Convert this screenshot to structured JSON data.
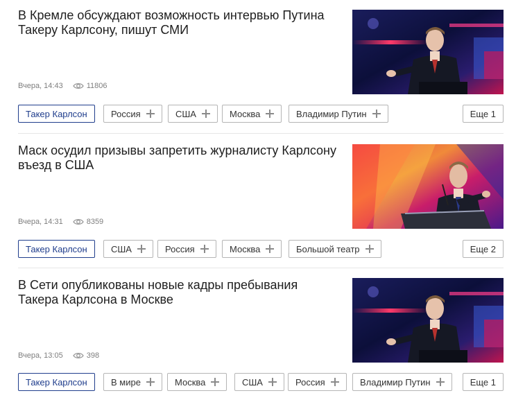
{
  "articles": [
    {
      "title": "В Кремле обсуждают возможность интервью Путина Такеру Карлсону, пишут СМИ",
      "date": "Вчера, 14:43",
      "views": "11806",
      "tags": [
        {
          "label": "Такер Карлсон",
          "active": true
        },
        {
          "label": "Россия"
        },
        {
          "label": "США"
        },
        {
          "label": "Москва"
        },
        {
          "label": "Владимир Путин"
        }
      ],
      "more_label": "Еще 1"
    },
    {
      "title": "Маск осудил призывы запретить журналисту Карлсону въезд в США",
      "date": "Вчера, 14:31",
      "views": "8359",
      "tags": [
        {
          "label": "Такер Карлсон",
          "active": true
        },
        {
          "label": "США"
        },
        {
          "label": "Россия"
        },
        {
          "label": "Москва"
        },
        {
          "label": "Большой театр"
        }
      ],
      "more_label": "Еще 2"
    },
    {
      "title": "В Сети опубликованы новые кадры пребывания Такера Карлсона в Москве",
      "date": "Вчера, 13:05",
      "views": "398",
      "tags": [
        {
          "label": "Такер Карлсон",
          "active": true
        },
        {
          "label": "В мире"
        },
        {
          "label": "Москва"
        },
        {
          "label": "США"
        },
        {
          "label": "Россия"
        },
        {
          "label": "Владимир Путин"
        }
      ],
      "more_label": "Еще 1"
    }
  ],
  "icons": {
    "views": "eye-icon",
    "add_tag": "plus-icon"
  },
  "colors": {
    "active_tag": "#1f3d8c",
    "meta_text": "#7e7e7e",
    "tag_border": "#b5b5b5"
  }
}
